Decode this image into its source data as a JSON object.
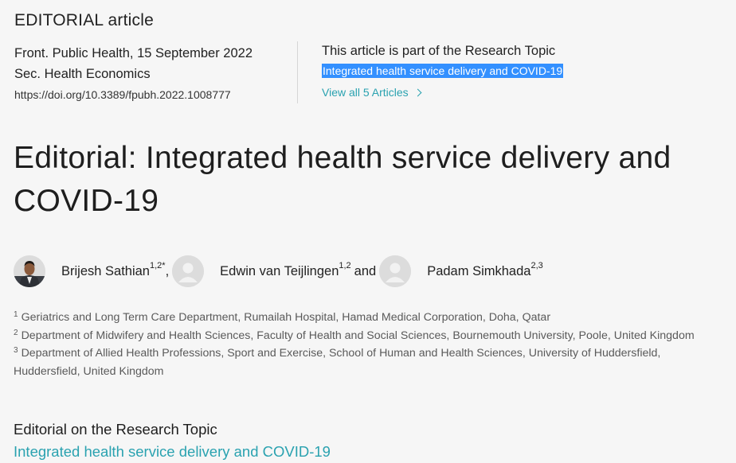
{
  "article_type": "EDITORIAL article",
  "meta": {
    "journal_date": "Front. Public Health, 15 September 2022",
    "section": "Sec. Health Economics",
    "doi": "https://doi.org/10.3389/fpubh.2022.1008777"
  },
  "research_topic": {
    "heading": "This article is part of the Research Topic",
    "link": "Integrated health service delivery and COVID-19",
    "view_all": "View all 5 Articles",
    "selection_color": "#3390ff"
  },
  "title": "Editorial: Integrated health service delivery and COVID-19",
  "authors": [
    {
      "name": "Brijesh Sathian",
      "sup": "1,2*",
      "separator": ",",
      "avatar": "photo"
    },
    {
      "name": "Edwin van Teijlingen",
      "sup": "1,2",
      "separator": "and",
      "avatar": "placeholder"
    },
    {
      "name": "Padam Simkhada",
      "sup": "2,3",
      "separator": "",
      "avatar": "placeholder"
    }
  ],
  "affiliations": [
    {
      "num": "1",
      "text": "Geriatrics and Long Term Care Department, Rumailah Hospital, Hamad Medical Corporation, Doha, Qatar"
    },
    {
      "num": "2",
      "text": "Department of Midwifery and Health Sciences, Faculty of Health and Social Sciences, Bournemouth University, Poole, United Kingdom"
    },
    {
      "num": "3",
      "text": "Department of Allied Health Professions, Sport and Exercise, School of Human and Health Sciences, University of Huddersfield, Huddersfield, United Kingdom"
    }
  ],
  "editorial_on": {
    "label": "Editorial on the Research Topic",
    "topic": "Integrated health service delivery and COVID-19"
  },
  "colors": {
    "accent": "#2aa2b0",
    "background": "#f6f6f6"
  }
}
